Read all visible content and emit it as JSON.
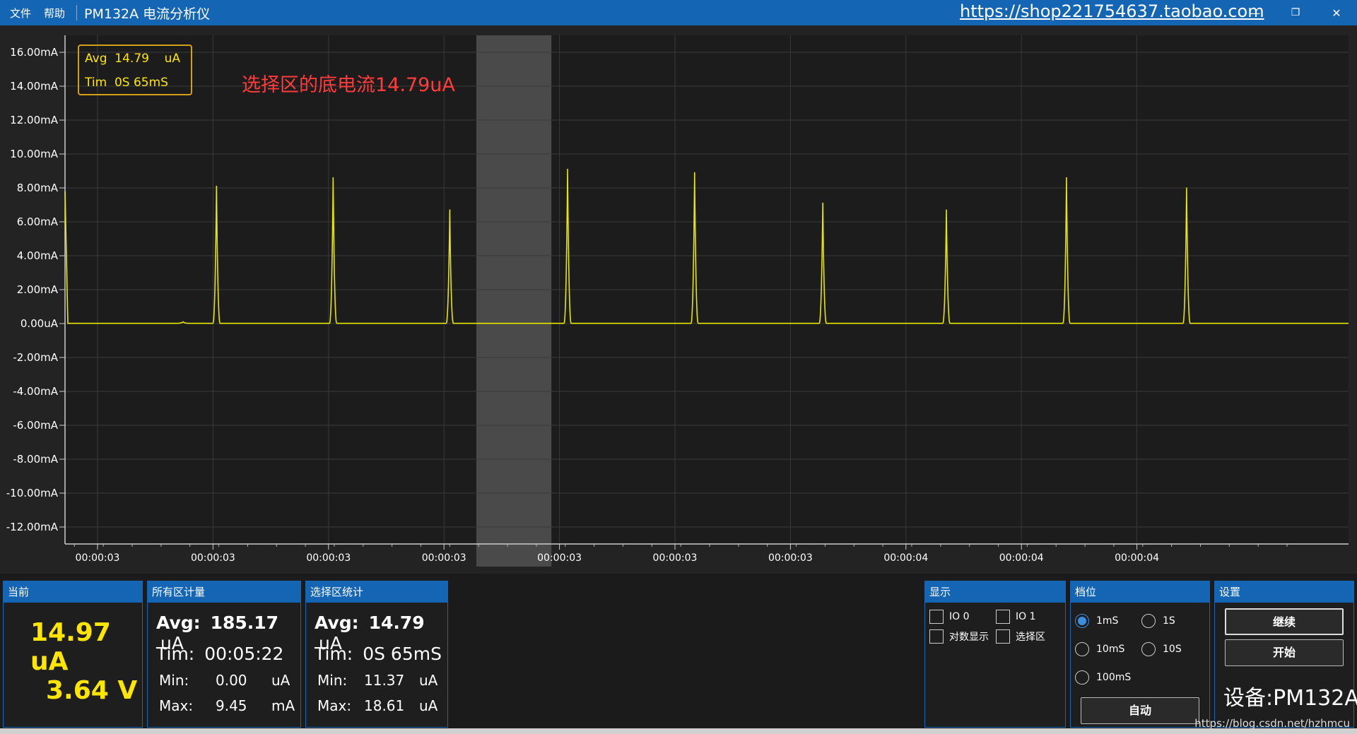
{
  "titlebar": {
    "menu": [
      "文件",
      "帮助"
    ],
    "app_title": "PM132A 电流分析仪",
    "shop_link": "https://shop221754637.taobao.com",
    "minimize_icon": "—",
    "restore_icon": "❐",
    "close_icon": "✕"
  },
  "overlay": {
    "avg_label": "Avg  14.79    uA",
    "tim_label": "Tim  0S 65mS",
    "annotation": "选择区的底电流14.79uA"
  },
  "chart_data": {
    "type": "line",
    "series": [
      {
        "color": "#e6e600",
        "baseline": 0.0148,
        "spikes": [
          {
            "x": 0.103,
            "y": 8.1
          },
          {
            "x": 0.204,
            "y": 8.6
          },
          {
            "x": 0.305,
            "y": 6.7
          },
          {
            "x": 0.407,
            "y": 9.1
          },
          {
            "x": 0.517,
            "y": 8.9
          },
          {
            "x": 0.628,
            "y": 7.1
          },
          {
            "x": 0.735,
            "y": 6.7
          },
          {
            "x": 0.839,
            "y": 8.6
          },
          {
            "x": 0.943,
            "y": 8.0
          }
        ],
        "small_bumps": [
          {
            "x": 0.074,
            "y": 0.1
          }
        ]
      }
    ],
    "ylim": [
      -13.0,
      17.0
    ],
    "yticks": [
      {
        "v": 16,
        "label": "16.00mA"
      },
      {
        "v": 14,
        "label": "14.00mA"
      },
      {
        "v": 12,
        "label": "12.00mA"
      },
      {
        "v": 10,
        "label": "10.00mA"
      },
      {
        "v": 8,
        "label": "8.00mA"
      },
      {
        "v": 6,
        "label": "6.00mA"
      },
      {
        "v": 4,
        "label": "4.00mA"
      },
      {
        "v": 2,
        "label": "2.00mA"
      },
      {
        "v": 0,
        "label": "0.00uA"
      },
      {
        "v": -2,
        "label": "-2.00mA"
      },
      {
        "v": -4,
        "label": "-4.00mA"
      },
      {
        "v": -6,
        "label": "-6.00mA"
      },
      {
        "v": -8,
        "label": "-8.00mA"
      },
      {
        "v": -10,
        "label": "-10.00mA"
      },
      {
        "v": -12,
        "label": "-12.00mA"
      }
    ],
    "xticks": [
      {
        "x": 0.0,
        "label": "00:00:03"
      },
      {
        "x": 0.1,
        "label": "00:00:03"
      },
      {
        "x": 0.2,
        "label": "00:00:03"
      },
      {
        "x": 0.3,
        "label": "00:00:03"
      },
      {
        "x": 0.4,
        "label": "00:00:03"
      },
      {
        "x": 0.5,
        "label": "00:00:03"
      },
      {
        "x": 0.6,
        "label": "00:00:03"
      },
      {
        "x": 0.7,
        "label": "00:00:04"
      },
      {
        "x": 0.8,
        "label": "00:00:04"
      },
      {
        "x": 0.9,
        "label": "00:00:04"
      }
    ],
    "selection": {
      "start": 0.328,
      "end": 0.393
    },
    "grid": true
  },
  "panels": {
    "current": {
      "title": "当前",
      "current": "14.97 uA",
      "voltage": "3.64 V"
    },
    "all": {
      "title": "所有区计量",
      "avg_label": "Avg:",
      "avg_value": "185.17",
      "avg_unit": "uA",
      "tim_label": "Tim:",
      "tim_value": "00:05:22",
      "min_label": "Min:",
      "min_value": "0.00",
      "min_unit": "uA",
      "max_label": "Max:",
      "max_value": "9.45",
      "max_unit": "mA"
    },
    "selection": {
      "title": "选择区统计",
      "avg_label": "Avg:",
      "avg_value": "14.79",
      "avg_unit": "uA",
      "tim_label": "Tim:",
      "tim_value": "0S 65mS",
      "min_label": "Min:",
      "min_value": "11.37",
      "min_unit": "uA",
      "max_label": "Max:",
      "max_value": "18.61",
      "max_unit": "uA"
    },
    "display": {
      "title": "显示",
      "io0": "IO 0",
      "io1": "IO 1",
      "log": "对数显示",
      "select": "选择区"
    },
    "range": {
      "title": "档位",
      "r1ms": "1mS",
      "r1s": "1S",
      "r10ms": "10mS",
      "r10s": "10S",
      "r100ms": "100mS",
      "auto": "自动"
    },
    "settings": {
      "title": "设置",
      "continue": "继续",
      "start": "开始",
      "device": "设备:PM132A"
    }
  },
  "watermark": "https://blog.csdn.net/hzhmcu"
}
